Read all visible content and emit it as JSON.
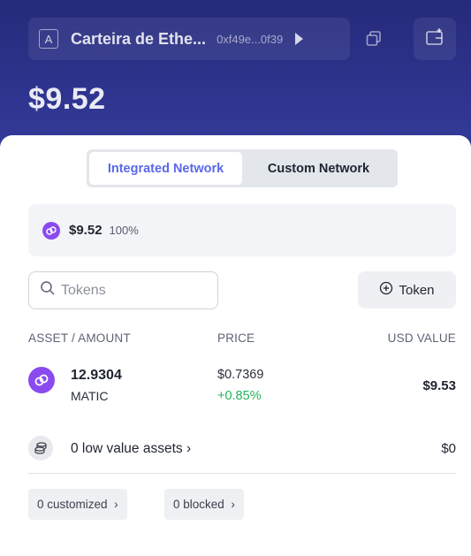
{
  "header": {
    "account_badge": "A",
    "account_name": "Carteira de Ethe...",
    "account_address": "0xf49e...0f39",
    "balance": "$9.52"
  },
  "network_tabs": [
    {
      "label": "Integrated Network",
      "active": true
    },
    {
      "label": "Custom Network",
      "active": false
    }
  ],
  "network_summary": {
    "amount": "$9.52",
    "percent": "100%"
  },
  "search": {
    "placeholder": "Tokens"
  },
  "add_token": {
    "label": "Token"
  },
  "table": {
    "col_asset": "ASSET / AMOUNT",
    "col_price": "PRICE",
    "col_value": "USD VALUE",
    "rows": [
      {
        "amount": "12.9304",
        "symbol": "MATIC",
        "price": "$0.7369",
        "change": "+0.85%",
        "usd_value": "$9.53"
      }
    ]
  },
  "low_value": {
    "label": "0 low value assets",
    "usd": "$0"
  },
  "chips": {
    "customized": "0 customized",
    "blocked": "0 blocked"
  },
  "colors": {
    "header_bg": "#2e348e",
    "accent": "#5a68e8",
    "polygon_purple": "#8a4af0",
    "positive": "#22b35a"
  },
  "icons": {
    "copy": "copy-icon",
    "wallet_add": "wallet-add-icon",
    "search": "search-icon",
    "plus_circle": "plus-circle-icon",
    "polygon": "polygon-icon",
    "coins": "coins-icon",
    "chevron": "chevron-right-icon"
  }
}
